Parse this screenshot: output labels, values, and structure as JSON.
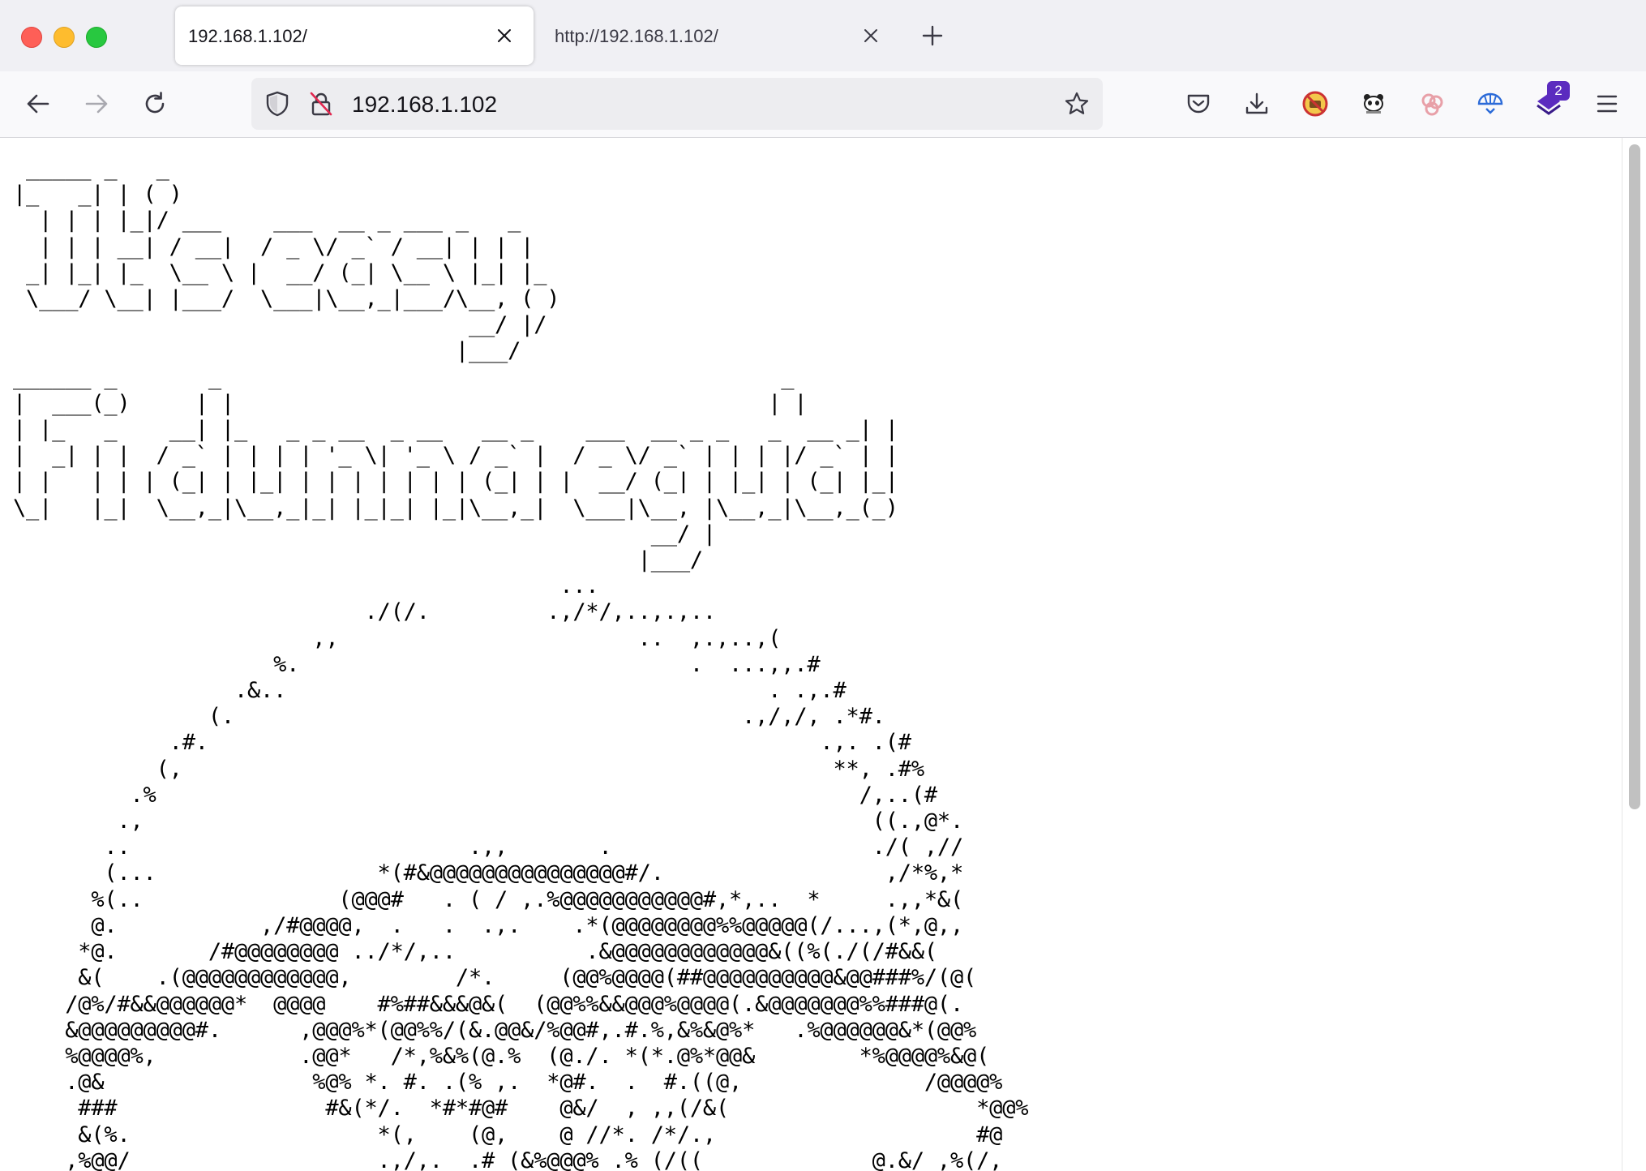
{
  "browser": {
    "tabs": [
      {
        "title": "192.168.1.102/",
        "active": true
      },
      {
        "title": "http://192.168.1.102/",
        "active": false
      }
    ],
    "address": "192.168.1.102",
    "extension_badge": "2"
  },
  "icons": {
    "back": "back-arrow-icon",
    "forward": "forward-arrow-icon",
    "reload": "reload-icon",
    "shield": "tracking-shield-icon",
    "insecure": "insecure-lock-icon",
    "bookmark": "star-icon",
    "pocket": "pocket-icon",
    "downloads": "download-icon",
    "menu": "hamburger-menu-icon"
  },
  "colors": {
    "tabstrip": "#f0f0f4",
    "navbar": "#f9f9fb",
    "urlbar": "#ededf0",
    "badge": "#5b2bbf"
  },
  "page": {
    "ascii_art": " _____ _   _\n|_   _| | ( )\n  | | | |_|/ ___    ___  __ _ ___ _   _\n  | | | __| / __|  / _ \\/ _` / __| | | |\n _| |_| |_  \\__ \\ |  __/ (_| \\__ \\ |_| |_\n \\___/ \\__| |___/  \\___|\\__,_|___/\\__, ( )\n                                   __/ |/\n                                  |___/\n______ _       _                                           _\n|  ___(_)     | |                                         | |\n| |_   _    __| |_   _ _ __  _ __   __ _    ___  __ _ _   _  __ _| |\n|  _| | |  / _` | | | | '_ \\| '_ \\ / _` |  / _ \\/ _` | | | |/ _` | |\n| |   | | | (_| | |_| | | | | | | | (_| | |  __/ (_| | |_| | (_| |_|\n\\_|   |_|  \\__,_|\\__,_|_| |_|_| |_|\\__,_|  \\___|\\__, |\\__,_|\\__,_(_)\n                                                 __/ |\n                                                |___/\n                                          ...\n                           ./(/.         .,/*/,..,.,..\n                       ,,                       ..  ,.,..,(\n                    %.                              .  ...,,.#\n                 .&..                                     . .,.#\n               (.                                       .,/,/, .*#.\n            .#.                                               .,. .(#\n           (,                                                  **, .#%\n         .%                                                      /,..(#\n        .,                                                        ((.,@*.\n       ..                          .,,       .                    ./( ,//\n       (...                 *(#&@@@@@@@@@@@@@@@#/.                 ,/*%,*\n      %(..               (@@@#   . ( / ,.%@@@@@@@@@@@#,*,..  *     .,,*&(\n      @.           ,/#@@@@,  .   .  .,.    .*(@@@@@@@@%%@@@@@(/...,(*,@,,\n     *@.       /#@@@@@@@@ ../*/,..          .&@@@@@@@@@@@@&((%(./(/#&&(\n     &(    .(@@@@@@@@@@@@,        /*.     (@@%@@@@(##@@@@@@@@@@&@@###%/(@(\n    /@%/#&&@@@@@@*  @@@@    #%##&&&@&(  (@@%%&&@@@%@@@@(.&@@@@@@@%%###@(.\n    &@@@@@@@@@#.      ,@@@%*(@@%%/(&.@@&/%@@#,.#.%,&%&@%*   .%@@@@@@&*(@@%\n    %@@@@%,           .@@*   /*,%&%(@.%  (@./. *(*.@%*@@&        *%@@@@%&@(\n    .@&                %@% *. #. .(% ,.  *@#.  .  #.((@,              /@@@@%\n     ###                #&(*/.  *#*#@#    @&/  , ,,(/&(                   *@@%\n     &(%.                   *(,    (@,    @ //*. /*/.,                    #@\n    ,%@@/                   .,/,.  .# (&%@@@% .% (/((             @.&/ ,%(/,"
  }
}
